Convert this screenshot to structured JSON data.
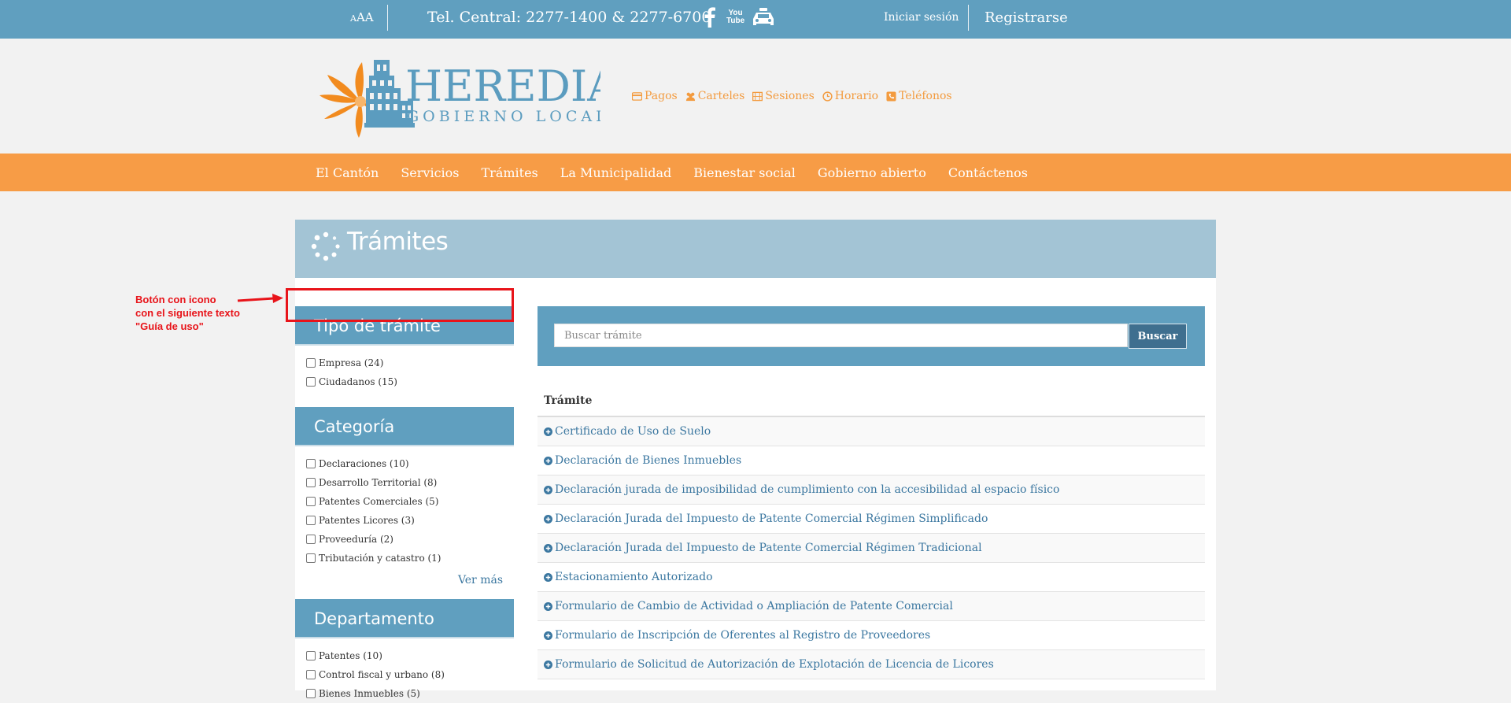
{
  "topbar": {
    "font_small": "A",
    "font_big": "AA",
    "phone": "Tel. Central: 2277-1400 & 2277-6700",
    "social_icons": [
      "facebook-icon",
      "youtube-icon",
      "taxi-icon"
    ],
    "youtube_you": "You",
    "youtube_tube": "Tube",
    "login": "Iniciar sesión",
    "register": "Registrarse"
  },
  "logo": {
    "name": "HEREDIA",
    "subtitle": "GOBIERNO LOCAL",
    "colors": {
      "orange": "#f28b1f",
      "blue": "#5b9cbf"
    }
  },
  "quick_links": [
    {
      "label": "Pagos",
      "icon": "credit-card-icon"
    },
    {
      "label": "Carteles",
      "icon": "users-icon"
    },
    {
      "label": "Sesiones",
      "icon": "film-icon"
    },
    {
      "label": "Horario",
      "icon": "clock-icon"
    },
    {
      "label": "Teléfonos",
      "icon": "phone-icon"
    }
  ],
  "nav": [
    "El Cantón",
    "Servicios",
    "Trámites",
    "La Municipalidad",
    "Bienestar social",
    "Gobierno abierto",
    "Contáctenos"
  ],
  "page": {
    "title": "Trámites",
    "icon": "spinner-icon"
  },
  "filters": {
    "tipo": {
      "title": "Tipo de trámite",
      "items": [
        "Empresa (24)",
        "Ciudadanos (15)"
      ]
    },
    "categoria": {
      "title": "Categoría",
      "items": [
        "Declaraciones (10)",
        "Desarrollo Territorial (8)",
        "Patentes Comerciales (5)",
        "Patentes Licores (3)",
        "Proveeduría (2)",
        "Tributación y catastro (1)"
      ],
      "more": "Ver más"
    },
    "departamento": {
      "title": "Departamento",
      "items": [
        "Patentes (10)",
        "Control fiscal y urbano (8)",
        "Bienes Inmuebles (5)"
      ]
    }
  },
  "search": {
    "placeholder": "Buscar trámite",
    "button": "Buscar"
  },
  "table": {
    "header": "Trámite",
    "rows": [
      "Certificado de Uso de Suelo",
      "Declaración de Bienes Inmuebles",
      "Declaración jurada de imposibilidad de cumplimiento con la accesibilidad al espacio físico",
      "Declaración Jurada del Impuesto de Patente Comercial Régimen Simplificado",
      "Declaración Jurada del Impuesto de Patente Comercial Régimen Tradicional",
      "Estacionamiento Autorizado",
      "Formulario de Cambio de Actividad o Ampliación de Patente Comercial",
      "Formulario de Inscripción de Oferentes al Registro de Proveedores",
      "Formulario de Solicitud de Autorización de Explotación de Licencia de Licores"
    ]
  },
  "annotation": {
    "lines": [
      "Botón con icono",
      "con el siguiente texto",
      "\"Guía de uso\""
    ],
    "color": "#e8141a"
  },
  "colors": {
    "topbar": "#609fbf",
    "nav": "#f79c46",
    "banner": "#a3c4d5",
    "link": "#3b77a0",
    "quick_link": "#f39b3f"
  }
}
